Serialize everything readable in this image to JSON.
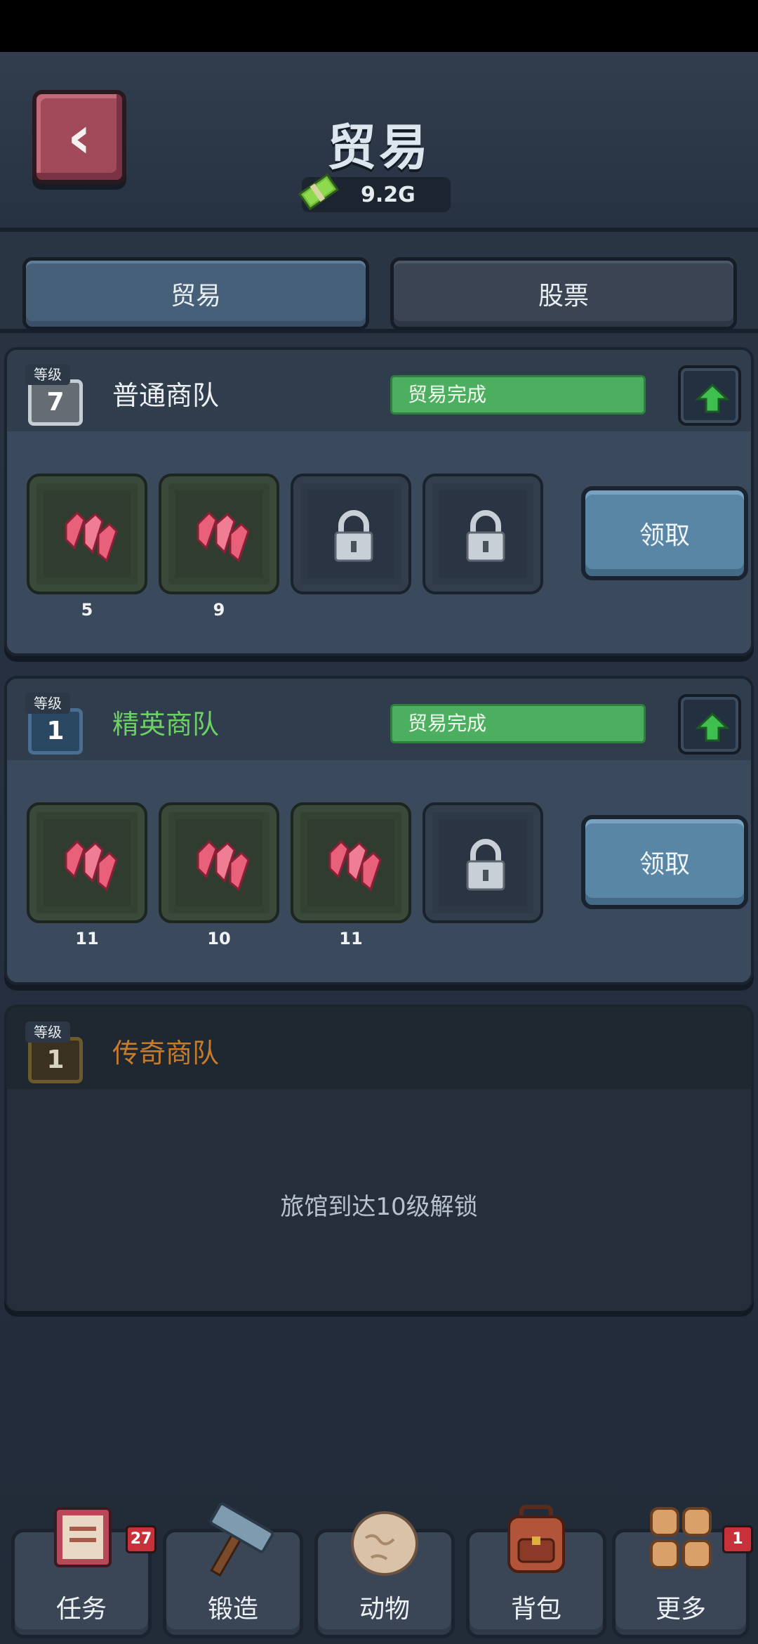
{
  "header": {
    "title": "贸易",
    "currency_value": "9.2G"
  },
  "tabs": [
    {
      "label": "贸易",
      "active": true
    },
    {
      "label": "股票",
      "active": false
    }
  ],
  "caravans": [
    {
      "level_tag": "等级",
      "level": "7",
      "name": "普通商队",
      "status": "贸易完成",
      "slots": [
        {
          "count": "5"
        },
        {
          "count": "9"
        }
      ],
      "claim_label": "领取"
    },
    {
      "level_tag": "等级",
      "level": "1",
      "name": "精英商队",
      "status": "贸易完成",
      "slots": [
        {
          "count": "11"
        },
        {
          "count": "10"
        },
        {
          "count": "11"
        }
      ],
      "claim_label": "领取"
    },
    {
      "level_tag": "等级",
      "level": "1",
      "name": "传奇商队",
      "unlock_message": "旅馆到达10级解锁"
    }
  ],
  "nav": {
    "items": [
      {
        "label": "任务",
        "badge": "27"
      },
      {
        "label": "锻造"
      },
      {
        "label": "动物"
      },
      {
        "label": "背包"
      },
      {
        "label": "更多",
        "badge": "1"
      }
    ]
  },
  "colors": {
    "complete": "#4cae5f",
    "elite_name": "#6cd165",
    "legend_name": "#c77b2c",
    "badge": "#c8303a"
  }
}
